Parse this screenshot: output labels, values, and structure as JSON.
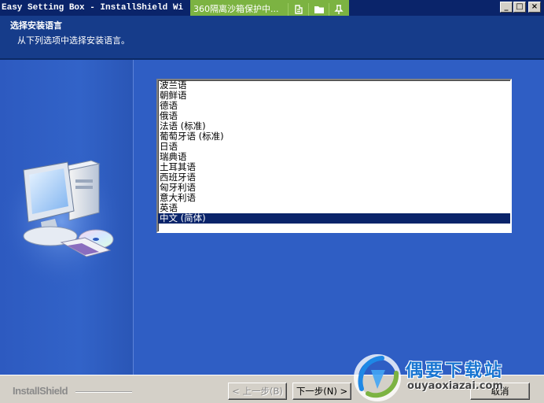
{
  "window": {
    "title": "Easy Setting Box - InstallShield Wi",
    "controls": [
      "minimize-icon",
      "maximize-icon",
      "close-icon"
    ]
  },
  "sandbox_bar": {
    "text": "360隔离沙箱保护中...",
    "icons": [
      "shield-icon",
      "folder-icon",
      "pin-icon"
    ]
  },
  "header": {
    "title": "选择安装语言",
    "subtitle": "从下列选项中选择安装语言。"
  },
  "language_list": {
    "items": [
      "波兰语",
      "朝鲜语",
      "德语",
      "俄语",
      "法语 (标准)",
      "葡萄牙语 (标准)",
      "日语",
      "瑞典语",
      "土耳其语",
      "西班牙语",
      "匈牙利语",
      "意大利语",
      "英语",
      "中文 (简体)"
    ],
    "selected_index": 13
  },
  "footer": {
    "brand": "InstallShield",
    "back_button": "< 上一步(B)",
    "next_button": "下一步(N) >",
    "cancel_button": "取消"
  },
  "watermark": {
    "title": "偶要下载站",
    "url": "ouyaoxiazai.com"
  },
  "colors": {
    "title_bar": "#0a246a",
    "header": "#163c8a",
    "body": "#2f5ec4",
    "selection": "#0a246a",
    "sandbox": "#7cb342"
  }
}
